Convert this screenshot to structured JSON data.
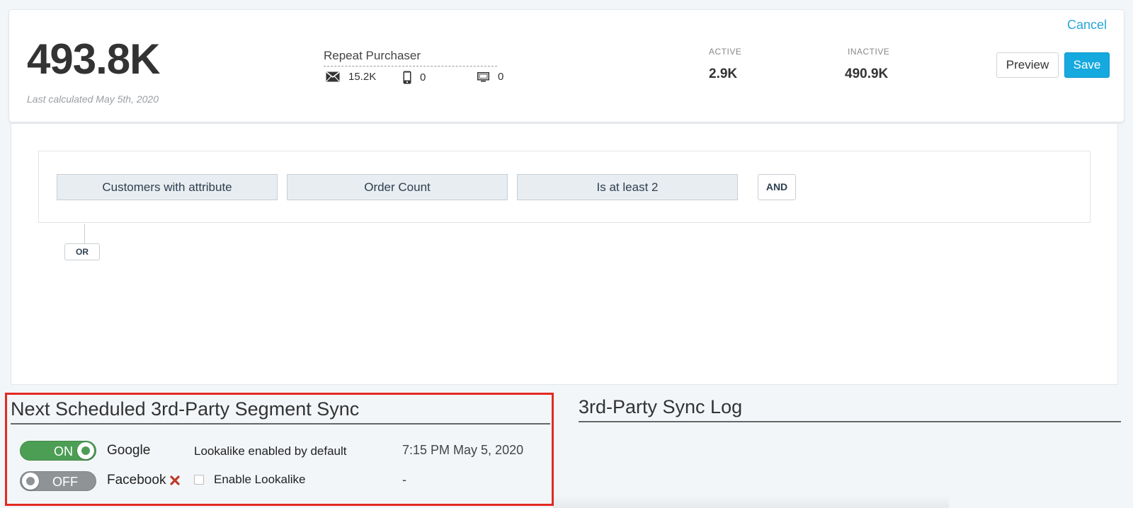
{
  "summary": {
    "total_count": "493.8K",
    "last_calculated": "Last calculated May 5th, 2020"
  },
  "segment": {
    "name": "Repeat Purchaser",
    "channels": [
      {
        "icon": "envelope-icon",
        "count": "15.2K"
      },
      {
        "icon": "mobile-phone-icon",
        "count": "0"
      },
      {
        "icon": "desktop-icon",
        "count": "0"
      }
    ]
  },
  "stats": {
    "active_label": "ACTIVE",
    "active_value": "2.9K",
    "inactive_label": "INACTIVE",
    "inactive_value": "490.9K"
  },
  "actions": {
    "cancel_label": "Cancel",
    "preview_label": "Preview",
    "save_label": "Save"
  },
  "builder": {
    "conditions": [
      "Customers with attribute",
      "Order Count",
      "Is at least 2"
    ],
    "and_label": "AND",
    "or_label": "OR"
  },
  "sync": {
    "title": "Next Scheduled 3rd-Party Segment Sync",
    "rows": [
      {
        "toggle": "ON",
        "platform": "Google",
        "lookalike": "Lookalike enabled by default",
        "time": "7:15 PM May 5, 2020"
      },
      {
        "toggle": "OFF",
        "platform": "Facebook",
        "lookalike": "Enable Lookalike",
        "time": "-"
      }
    ]
  },
  "log": {
    "title": "3rd-Party Sync Log"
  },
  "colors": {
    "accent": "#16a9df",
    "toggle_on": "#4d9e55",
    "toggle_off": "#8f9396",
    "highlight_border": "#e32a22",
    "error_x": "#c0392b"
  }
}
